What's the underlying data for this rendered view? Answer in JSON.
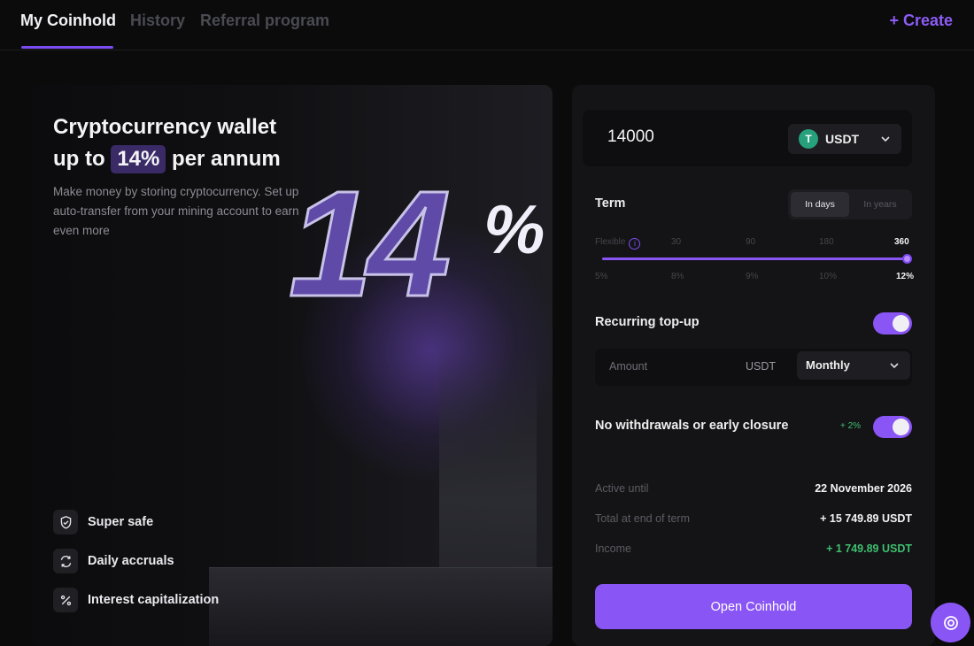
{
  "nav": {
    "tabs": [
      {
        "label": "My Coinhold",
        "active": true
      },
      {
        "label": "History",
        "active": false
      },
      {
        "label": "Referral program",
        "active": false
      }
    ],
    "create_label": "+ Create"
  },
  "hero": {
    "title_line1": "Cryptocurrency wallet",
    "title_prefix": "up to",
    "title_rate": "14%",
    "title_suffix": "per annum",
    "description": "Make money by storing cryptocurrency. Set up auto-transfer from your mining account to earn even more",
    "big_number": "14",
    "big_symbol": "%",
    "features": [
      {
        "label": "Super safe",
        "icon": "shield-check-icon"
      },
      {
        "label": "Daily accruals",
        "icon": "refresh-arrows-icon"
      },
      {
        "label": "Interest capitalization",
        "icon": "percent-icon"
      }
    ]
  },
  "form": {
    "amount_value": "14000",
    "currency": "USDT",
    "currency_icon": "T",
    "term_label": "Term",
    "term_modes": [
      {
        "label": "In days",
        "active": true
      },
      {
        "label": "In years",
        "active": false
      }
    ],
    "term_scale": [
      "Flexible",
      "30",
      "90",
      "180",
      "360"
    ],
    "rate_scale": [
      "5%",
      "8%",
      "9%",
      "10%",
      "12%"
    ],
    "term_selected_fraction": 1.0,
    "recurring_label": "Recurring top-up",
    "recurring_enabled": true,
    "recurring_amount_placeholder": "Amount",
    "recurring_currency": "USDT",
    "recurring_period": "Monthly",
    "no_withdrawals_label": "No withdrawals or early closure",
    "no_withdrawals_bonus": "+ 2%",
    "no_withdrawals_enabled": true
  },
  "summary": [
    {
      "key": "Active until",
      "value": "22 November 2026"
    },
    {
      "key": "Total at end of term",
      "value": "+ 15 749.89 USDT"
    },
    {
      "key": "Income",
      "value": "+ 1 749.89 USDT"
    }
  ],
  "open_button_label": "Open Coinhold",
  "colors": {
    "accent": "#8a55f5",
    "positive": "#3fbf6f",
    "tether": "#26a17b"
  }
}
